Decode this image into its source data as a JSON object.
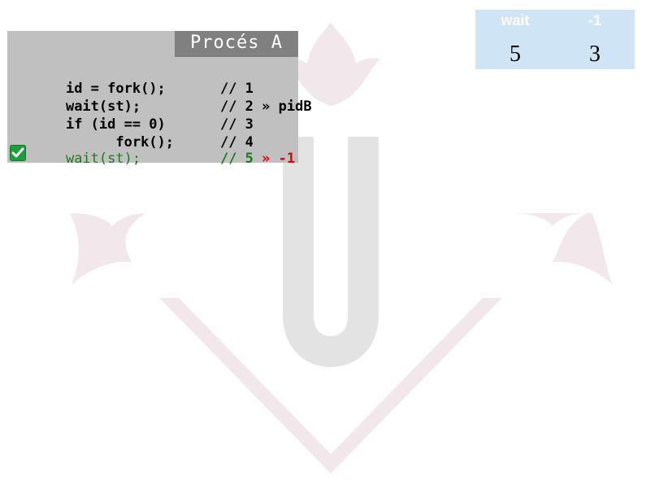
{
  "panel": {
    "title": "Procés A",
    "lines": [
      {
        "stmt": "id = fork();",
        "comment": "// 1",
        "annotation": ""
      },
      {
        "stmt": "wait(st);",
        "comment": "// 2",
        "annotation": " » pidB"
      },
      {
        "stmt": "if (id == 0)",
        "comment": "// 3",
        "annotation": ""
      },
      {
        "stmt": "      fork();",
        "comment": "// 4",
        "annotation": ""
      },
      {
        "stmt": "wait(st);",
        "comment": "// 5",
        "arrow": " »",
        "value": " -1"
      }
    ]
  },
  "table": {
    "headers": [
      "wait",
      "-1"
    ],
    "values": [
      "5",
      "3"
    ]
  },
  "icons": {
    "check": "check-icon"
  },
  "colors": {
    "current_line": "#1e7b1e",
    "return_value": "#e00000",
    "header_bg": "#cfe5f5",
    "watermark": "#f1e6ea"
  }
}
